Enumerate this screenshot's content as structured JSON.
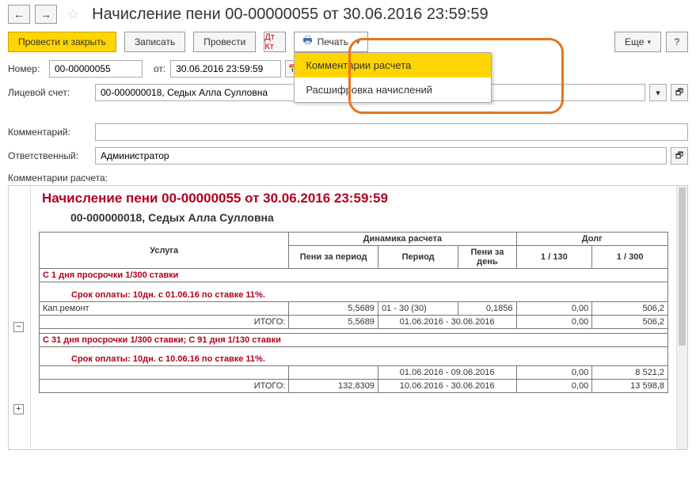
{
  "header": {
    "title": "Начисление пени 00-00000055 от 30.06.2016 23:59:59"
  },
  "toolbar": {
    "post_close": "Провести и закрыть",
    "save": "Записать",
    "post": "Провести",
    "print": "Печать",
    "more": "Еще",
    "help": "?"
  },
  "print_menu": {
    "item1": "Комментарии расчета",
    "item2": "Расшифровка начислений"
  },
  "fields": {
    "number_label": "Номер:",
    "number": "00-00000055",
    "from_label": "от:",
    "date": "30.06.2016 23:59:59",
    "account_label": "Лицевой счет:",
    "account": "00-000000018, Седых Алла Сулловна",
    "comment_label": "Комментарий:",
    "responsible_label": "Ответственный:",
    "responsible": "Администратор",
    "report_label": "Комментарии расчета:"
  },
  "report": {
    "title": "Начисление пени 00-00000055 от 30.06.2016 23:59:59",
    "subtitle": "00-000000018, Седых Алла Сулловна",
    "headers": {
      "service": "Услуга",
      "dynamics": "Динамика расчета",
      "debt": "Долг",
      "peni_period": "Пени за период",
      "period": "Период",
      "peni_day": "Пени за день",
      "d130": "1 / 130",
      "d300": "1 / 300"
    },
    "group1": {
      "header": "С 1 дня просрочки 1/300 ставки",
      "term": "Срок оплаты: 10дн. с 01.06.16 по ставке 11%.",
      "r1_service": "Кап.ремонт",
      "r1_peni": "5,5689",
      "r1_period": "01 - 30 (30)",
      "r1_perday": "0,1856",
      "r1_d130": "0,00",
      "r1_d300": "506,2",
      "t_label": "ИТОГО:",
      "t_peni": "5,5689",
      "t_period": "01.06.2016 - 30.06.2016",
      "t_d130": "0,00",
      "t_d300": "506,2"
    },
    "group2": {
      "header": "С 31 дня просрочки 1/300 ставки; С 91 дня 1/130 ставки",
      "term": "Срок оплаты: 10дн. с 10.06.16 по ставке 11%.",
      "r1_period": "01.06.2016 - 09.06.2016",
      "r1_d130": "0,00",
      "r1_d300": "8 521,2",
      "t_label": "ИТОГО:",
      "t_peni": "132,8309",
      "t_period": "10.06.2016 - 30.06.2016",
      "t_d130": "0,00",
      "t_d300": "13 598,8"
    }
  }
}
